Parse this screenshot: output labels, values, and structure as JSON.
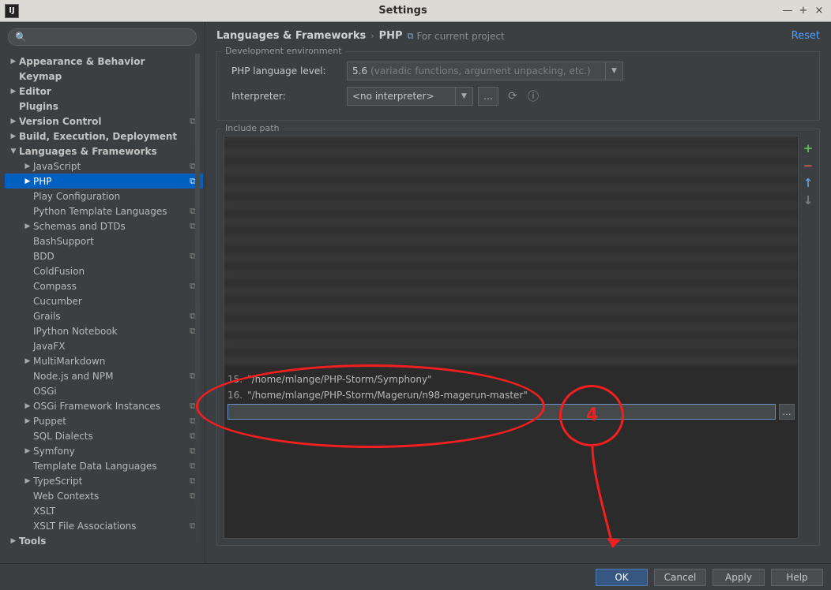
{
  "window": {
    "title": "Settings",
    "reset": "Reset"
  },
  "search": {
    "placeholder": ""
  },
  "breadcrumb": {
    "a": "Languages & Frameworks",
    "b": "PHP",
    "hint": "For current project"
  },
  "devenv": {
    "legend": "Development environment",
    "lang_label": "PHP language level:",
    "lang_value": "5.6",
    "lang_hint": "(variadic functions, argument unpacking, etc.)",
    "interp_label": "Interpreter:",
    "interp_value": "<no interpreter>"
  },
  "include": {
    "legend": "Include path",
    "rows": [
      {
        "num": "15.",
        "path": "\"/home/mlange/PHP-Storm/Symphony\""
      },
      {
        "num": "16.",
        "path": "\"/home/mlange/PHP-Storm/Magerun/n98-magerun-master\""
      }
    ],
    "input_value": ""
  },
  "buttons": {
    "ok": "OK",
    "cancel": "Cancel",
    "apply": "Apply",
    "help": "Help"
  },
  "tree": [
    {
      "d": 0,
      "label": "Appearance & Behavior",
      "arrow": "▶",
      "top": true
    },
    {
      "d": 0,
      "label": "Keymap",
      "arrow": "",
      "top": true
    },
    {
      "d": 0,
      "label": "Editor",
      "arrow": "▶",
      "top": true
    },
    {
      "d": 0,
      "label": "Plugins",
      "arrow": "",
      "top": true
    },
    {
      "d": 0,
      "label": "Version Control",
      "arrow": "▶",
      "top": true,
      "badge": true
    },
    {
      "d": 0,
      "label": "Build, Execution, Deployment",
      "arrow": "▶",
      "top": true
    },
    {
      "d": 0,
      "label": "Languages & Frameworks",
      "arrow": "▼",
      "top": true
    },
    {
      "d": 1,
      "label": "JavaScript",
      "arrow": "▶",
      "badge": true
    },
    {
      "d": 1,
      "label": "PHP",
      "arrow": "▶",
      "badge": true,
      "selected": true
    },
    {
      "d": 1,
      "label": "Play Configuration",
      "arrow": ""
    },
    {
      "d": 1,
      "label": "Python Template Languages",
      "arrow": "",
      "badge": true
    },
    {
      "d": 1,
      "label": "Schemas and DTDs",
      "arrow": "▶",
      "badge": true
    },
    {
      "d": 1,
      "label": "BashSupport",
      "arrow": ""
    },
    {
      "d": 1,
      "label": "BDD",
      "arrow": "",
      "badge": true
    },
    {
      "d": 1,
      "label": "ColdFusion",
      "arrow": ""
    },
    {
      "d": 1,
      "label": "Compass",
      "arrow": "",
      "badge": true
    },
    {
      "d": 1,
      "label": "Cucumber",
      "arrow": ""
    },
    {
      "d": 1,
      "label": "Grails",
      "arrow": "",
      "badge": true
    },
    {
      "d": 1,
      "label": "IPython Notebook",
      "arrow": "",
      "badge": true
    },
    {
      "d": 1,
      "label": "JavaFX",
      "arrow": ""
    },
    {
      "d": 1,
      "label": "MultiMarkdown",
      "arrow": "▶"
    },
    {
      "d": 1,
      "label": "Node.js and NPM",
      "arrow": "",
      "badge": true
    },
    {
      "d": 1,
      "label": "OSGi",
      "arrow": ""
    },
    {
      "d": 1,
      "label": "OSGi Framework Instances",
      "arrow": "▶",
      "badge": true
    },
    {
      "d": 1,
      "label": "Puppet",
      "arrow": "▶",
      "badge": true
    },
    {
      "d": 1,
      "label": "SQL Dialects",
      "arrow": "",
      "badge": true
    },
    {
      "d": 1,
      "label": "Symfony",
      "arrow": "▶",
      "badge": true
    },
    {
      "d": 1,
      "label": "Template Data Languages",
      "arrow": "",
      "badge": true
    },
    {
      "d": 1,
      "label": "TypeScript",
      "arrow": "▶",
      "badge": true
    },
    {
      "d": 1,
      "label": "Web Contexts",
      "arrow": "",
      "badge": true
    },
    {
      "d": 1,
      "label": "XSLT",
      "arrow": ""
    },
    {
      "d": 1,
      "label": "XSLT File Associations",
      "arrow": "",
      "badge": true
    },
    {
      "d": 0,
      "label": "Tools",
      "arrow": "▶",
      "top": true
    }
  ],
  "annotation_num": "4"
}
